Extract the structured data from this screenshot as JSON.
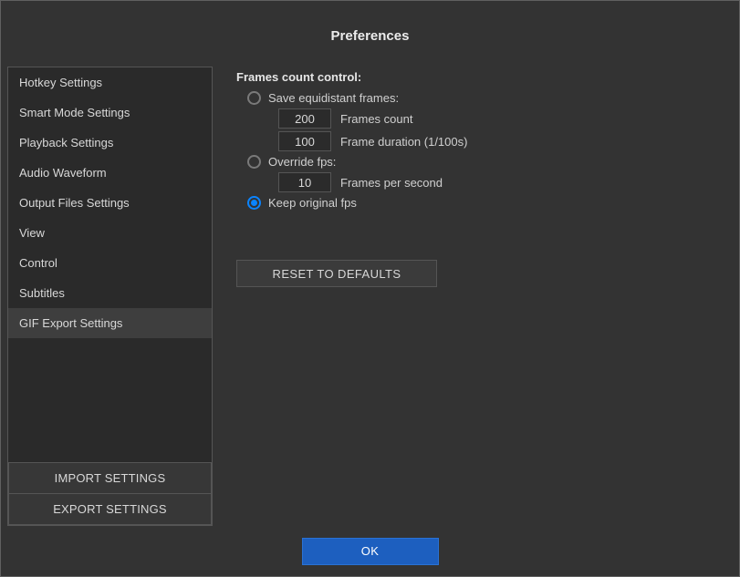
{
  "title": "Preferences",
  "sidebar": {
    "items": [
      {
        "label": "Hotkey Settings",
        "selected": false
      },
      {
        "label": "Smart Mode Settings",
        "selected": false
      },
      {
        "label": "Playback Settings",
        "selected": false
      },
      {
        "label": "Audio Waveform",
        "selected": false
      },
      {
        "label": "Output Files Settings",
        "selected": false
      },
      {
        "label": "View",
        "selected": false
      },
      {
        "label": "Control",
        "selected": false
      },
      {
        "label": "Subtitles",
        "selected": false
      },
      {
        "label": "GIF Export Settings",
        "selected": true
      }
    ],
    "import_label": "IMPORT SETTINGS",
    "export_label": "EXPORT SETTINGS"
  },
  "content": {
    "heading": "Frames count control:",
    "radios": {
      "save_equidistant": {
        "label": "Save equidistant frames:",
        "selected": false,
        "frames_count": {
          "value": "200",
          "label": "Frames count"
        },
        "frame_duration": {
          "value": "100",
          "label": "Frame duration (1/100s)"
        }
      },
      "override_fps": {
        "label": "Override fps:",
        "selected": false,
        "fps": {
          "value": "10",
          "label": "Frames per second"
        }
      },
      "keep_original": {
        "label": "Keep original fps",
        "selected": true
      }
    },
    "reset_label": "RESET TO DEFAULTS"
  },
  "footer": {
    "ok_label": "OK"
  }
}
